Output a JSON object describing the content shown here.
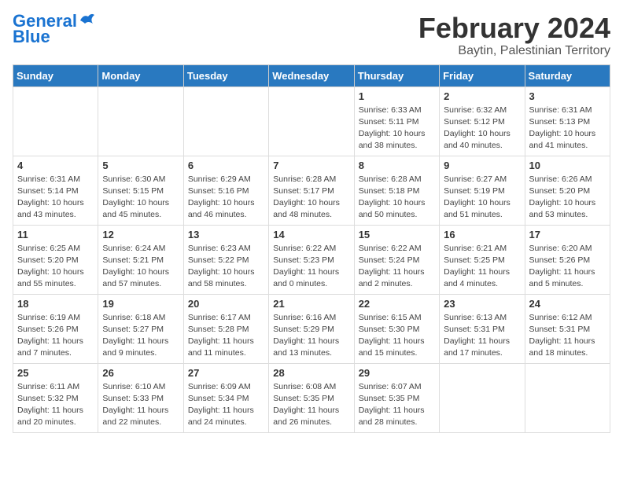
{
  "logo": {
    "line1": "General",
    "line2": "Blue"
  },
  "title": "February 2024",
  "subtitle": "Baytin, Palestinian Territory",
  "days_header": [
    "Sunday",
    "Monday",
    "Tuesday",
    "Wednesday",
    "Thursday",
    "Friday",
    "Saturday"
  ],
  "weeks": [
    [
      {
        "day": "",
        "info": ""
      },
      {
        "day": "",
        "info": ""
      },
      {
        "day": "",
        "info": ""
      },
      {
        "day": "",
        "info": ""
      },
      {
        "day": "1",
        "info": "Sunrise: 6:33 AM\nSunset: 5:11 PM\nDaylight: 10 hours\nand 38 minutes."
      },
      {
        "day": "2",
        "info": "Sunrise: 6:32 AM\nSunset: 5:12 PM\nDaylight: 10 hours\nand 40 minutes."
      },
      {
        "day": "3",
        "info": "Sunrise: 6:31 AM\nSunset: 5:13 PM\nDaylight: 10 hours\nand 41 minutes."
      }
    ],
    [
      {
        "day": "4",
        "info": "Sunrise: 6:31 AM\nSunset: 5:14 PM\nDaylight: 10 hours\nand 43 minutes."
      },
      {
        "day": "5",
        "info": "Sunrise: 6:30 AM\nSunset: 5:15 PM\nDaylight: 10 hours\nand 45 minutes."
      },
      {
        "day": "6",
        "info": "Sunrise: 6:29 AM\nSunset: 5:16 PM\nDaylight: 10 hours\nand 46 minutes."
      },
      {
        "day": "7",
        "info": "Sunrise: 6:28 AM\nSunset: 5:17 PM\nDaylight: 10 hours\nand 48 minutes."
      },
      {
        "day": "8",
        "info": "Sunrise: 6:28 AM\nSunset: 5:18 PM\nDaylight: 10 hours\nand 50 minutes."
      },
      {
        "day": "9",
        "info": "Sunrise: 6:27 AM\nSunset: 5:19 PM\nDaylight: 10 hours\nand 51 minutes."
      },
      {
        "day": "10",
        "info": "Sunrise: 6:26 AM\nSunset: 5:20 PM\nDaylight: 10 hours\nand 53 minutes."
      }
    ],
    [
      {
        "day": "11",
        "info": "Sunrise: 6:25 AM\nSunset: 5:20 PM\nDaylight: 10 hours\nand 55 minutes."
      },
      {
        "day": "12",
        "info": "Sunrise: 6:24 AM\nSunset: 5:21 PM\nDaylight: 10 hours\nand 57 minutes."
      },
      {
        "day": "13",
        "info": "Sunrise: 6:23 AM\nSunset: 5:22 PM\nDaylight: 10 hours\nand 58 minutes."
      },
      {
        "day": "14",
        "info": "Sunrise: 6:22 AM\nSunset: 5:23 PM\nDaylight: 11 hours\nand 0 minutes."
      },
      {
        "day": "15",
        "info": "Sunrise: 6:22 AM\nSunset: 5:24 PM\nDaylight: 11 hours\nand 2 minutes."
      },
      {
        "day": "16",
        "info": "Sunrise: 6:21 AM\nSunset: 5:25 PM\nDaylight: 11 hours\nand 4 minutes."
      },
      {
        "day": "17",
        "info": "Sunrise: 6:20 AM\nSunset: 5:26 PM\nDaylight: 11 hours\nand 5 minutes."
      }
    ],
    [
      {
        "day": "18",
        "info": "Sunrise: 6:19 AM\nSunset: 5:26 PM\nDaylight: 11 hours\nand 7 minutes."
      },
      {
        "day": "19",
        "info": "Sunrise: 6:18 AM\nSunset: 5:27 PM\nDaylight: 11 hours\nand 9 minutes."
      },
      {
        "day": "20",
        "info": "Sunrise: 6:17 AM\nSunset: 5:28 PM\nDaylight: 11 hours\nand 11 minutes."
      },
      {
        "day": "21",
        "info": "Sunrise: 6:16 AM\nSunset: 5:29 PM\nDaylight: 11 hours\nand 13 minutes."
      },
      {
        "day": "22",
        "info": "Sunrise: 6:15 AM\nSunset: 5:30 PM\nDaylight: 11 hours\nand 15 minutes."
      },
      {
        "day": "23",
        "info": "Sunrise: 6:13 AM\nSunset: 5:31 PM\nDaylight: 11 hours\nand 17 minutes."
      },
      {
        "day": "24",
        "info": "Sunrise: 6:12 AM\nSunset: 5:31 PM\nDaylight: 11 hours\nand 18 minutes."
      }
    ],
    [
      {
        "day": "25",
        "info": "Sunrise: 6:11 AM\nSunset: 5:32 PM\nDaylight: 11 hours\nand 20 minutes."
      },
      {
        "day": "26",
        "info": "Sunrise: 6:10 AM\nSunset: 5:33 PM\nDaylight: 11 hours\nand 22 minutes."
      },
      {
        "day": "27",
        "info": "Sunrise: 6:09 AM\nSunset: 5:34 PM\nDaylight: 11 hours\nand 24 minutes."
      },
      {
        "day": "28",
        "info": "Sunrise: 6:08 AM\nSunset: 5:35 PM\nDaylight: 11 hours\nand 26 minutes."
      },
      {
        "day": "29",
        "info": "Sunrise: 6:07 AM\nSunset: 5:35 PM\nDaylight: 11 hours\nand 28 minutes."
      },
      {
        "day": "",
        "info": ""
      },
      {
        "day": "",
        "info": ""
      }
    ]
  ]
}
